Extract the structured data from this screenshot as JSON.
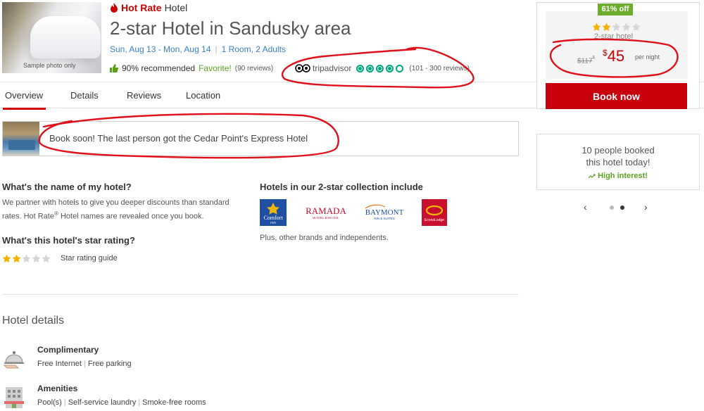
{
  "header": {
    "photo_caption": "Sample photo only",
    "brand_name": "Hot Rate",
    "brand_suffix": "Hotel",
    "title": "2-star Hotel in Sandusky area",
    "dates": "Sun, Aug 13 - Mon, Aug 14",
    "rooms": "1 Room,  2 Adults",
    "recommended": "90% recommended",
    "favorite": "Favorite!",
    "reviews": "(90 reviews)",
    "tripadvisor_name": "tripadvisor",
    "tripadvisor_rating": 4,
    "tripadvisor_reviews": "(101 - 300 reviews)"
  },
  "tabs": [
    {
      "label": "Overview",
      "active": true
    },
    {
      "label": "Details"
    },
    {
      "label": "Reviews"
    },
    {
      "label": "Location"
    }
  ],
  "urgency": {
    "message": "Book soon! The last person got the Cedar Point's Express Hotel"
  },
  "info": {
    "name_q": "What's the name of my hotel?",
    "name_a1": "We partner with hotels to give you deeper discounts than standard",
    "name_a2_pre": "rates. Hot Rate",
    "name_a2_reg": "®",
    "name_a2_post": " Hotel names are revealed once you book.",
    "rating_q": "What's this hotel's star rating?",
    "star_rating": 2,
    "star_guide": "Star rating guide",
    "collection_title": "Hotels in our 2-star collection include",
    "brands": {
      "comfort_1": "Comfort",
      "comfort_2": "INN",
      "ramada_1": "RAMADA",
      "ramada_2": "WORLDWIDE",
      "baymont_1": "BAYMONT",
      "baymont_2": "INN & SUITES",
      "econo": "EconoLodge"
    },
    "collection_note": "Plus, other brands and independents."
  },
  "hotel_details": {
    "heading": "Hotel details",
    "complimentary_title": "Complimentary",
    "complimentary_items": [
      "Free Internet",
      "Free parking"
    ],
    "amenities_title": "Amenities",
    "amenities_items": [
      "Pool(s)",
      "Self-service laundry",
      "Smoke-free rooms"
    ]
  },
  "price": {
    "discount": "61% off",
    "star_rating": 2,
    "star_label": "2-star hotel",
    "old_price": "$117",
    "old_mark": "*",
    "currency": "$",
    "price": "45",
    "per_night": "per night",
    "book_label": "Book now"
  },
  "interest": {
    "line1": "10 people booked",
    "line2": "this hotel today!",
    "line3": "High interest!"
  },
  "colors": {
    "brand_red": "#c8000e",
    "link_blue": "#3a82c4",
    "green": "#5ba31f",
    "tripadvisor": "#00a680",
    "star": "#f5b301"
  }
}
